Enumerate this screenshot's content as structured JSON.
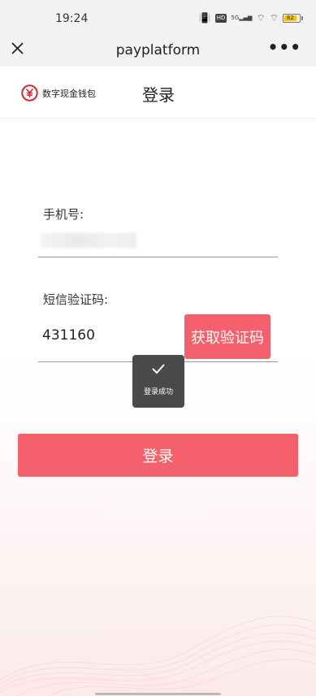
{
  "status_bar": {
    "time": "19:24",
    "hd_label": "HD",
    "network_label": "5G",
    "battery": "82"
  },
  "nav": {
    "title": "payplatform",
    "more": "•••"
  },
  "header": {
    "brand": "数字现金钱包",
    "title": "登录"
  },
  "form": {
    "phone_label": "手机号:",
    "code_label": "短信验证码:",
    "code_value": "431160",
    "sms_button": "获取验证码",
    "login_button": "登录"
  },
  "toast": {
    "text": "登录成功",
    "icon": "checkmark-icon"
  },
  "colors": {
    "accent": "#f4606c",
    "toast_bg": "#4a4a4a",
    "nav_bg": "#f2f2f2",
    "logo_red": "#d7262f"
  }
}
